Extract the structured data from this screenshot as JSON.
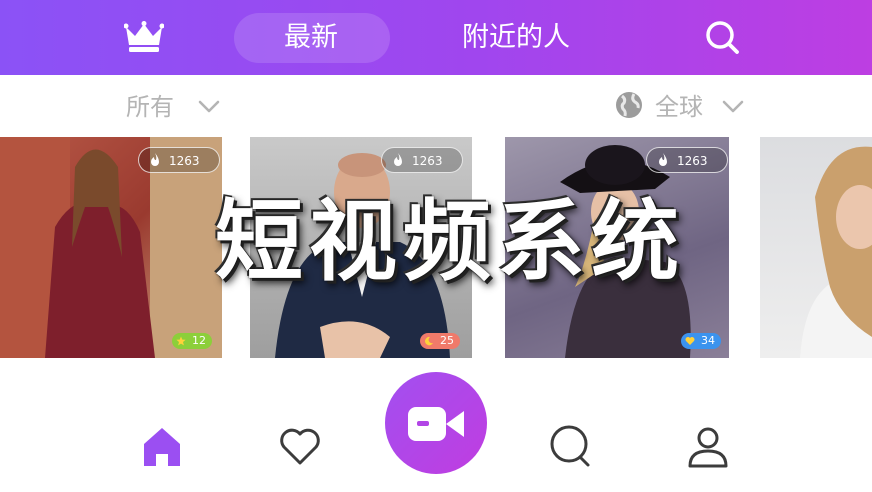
{
  "header": {
    "tabs": [
      {
        "label": "最新",
        "active": true
      },
      {
        "label": "附近的人",
        "active": false
      }
    ],
    "icons": [
      "crown-icon",
      "search-icon"
    ]
  },
  "filters": {
    "category": "所有",
    "region": "全球"
  },
  "cards": [
    {
      "views": "1263",
      "level": "12",
      "level_color": "#8ccf3a",
      "level_icon": "star"
    },
    {
      "views": "1263",
      "level": "25",
      "level_color": "#f07a6a",
      "level_icon": "moon"
    },
    {
      "views": "1263",
      "level": "34",
      "level_color": "#3b93ee",
      "level_icon": "heart"
    }
  ],
  "watermark": "短视频系统",
  "bottom_nav": {
    "items": [
      "home-icon",
      "heart-icon",
      "record-video-icon",
      "message-icon",
      "profile-icon"
    ],
    "active": "home-icon"
  },
  "colors": {
    "header_gradient_start": "#8b52f6",
    "header_gradient_end": "#bd3ee2",
    "accent": "#9b4ff2",
    "icon_gray": "#3c3c3c",
    "filter_text": "#b4b4b4"
  }
}
